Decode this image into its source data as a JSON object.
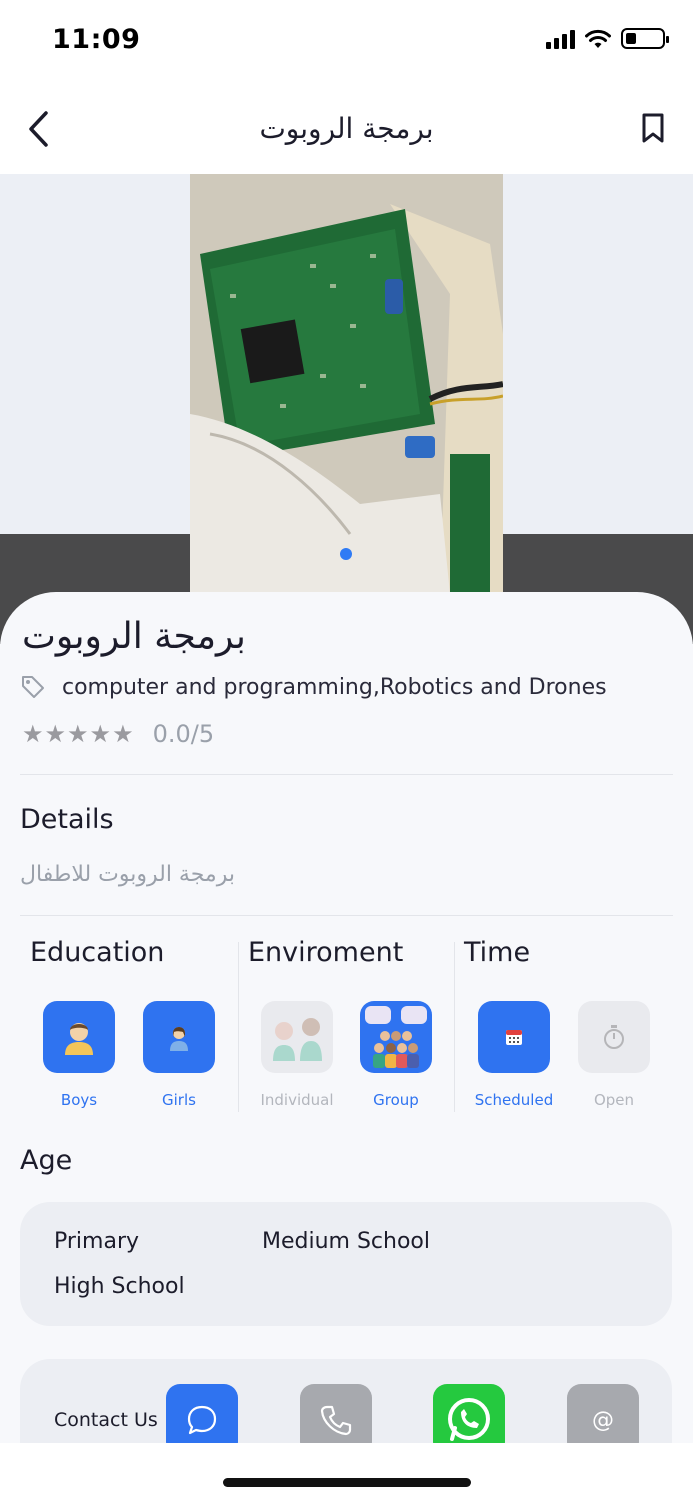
{
  "status_bar": {
    "time": "11:09",
    "battery_level": 0.3
  },
  "nav": {
    "title": "برمجة الروبوت",
    "back_icon": "chevron-left-icon",
    "bookmark_icon": "bookmark-icon"
  },
  "gallery": {
    "image": "circuit-board-photo",
    "page_count": 1,
    "current_page": 1,
    "active_dot_color": "#2f7bf5"
  },
  "course": {
    "title": "برمجة الروبوت",
    "tags": "computer and programming,Robotics and Drones",
    "stars": "★★★★★",
    "rating": "0.0/5"
  },
  "details": {
    "heading": "Details",
    "text": "برمجة الروبوت للاطفال"
  },
  "categories": {
    "education": {
      "heading": "Education",
      "options": [
        {
          "label": "Boys",
          "active": true,
          "icon": "boy-icon"
        },
        {
          "label": "Girls",
          "active": true,
          "icon": "girl-icon"
        }
      ]
    },
    "environment": {
      "heading": "Enviroment",
      "options": [
        {
          "label": "Individual",
          "active": false,
          "icon": "individual-icon"
        },
        {
          "label": "Group",
          "active": true,
          "icon": "group-icon"
        }
      ]
    },
    "time": {
      "heading": "Time",
      "options": [
        {
          "label": "Scheduled",
          "active": true,
          "icon": "calendar-icon"
        },
        {
          "label": "Open",
          "active": false,
          "icon": "stopwatch-icon"
        }
      ]
    }
  },
  "age": {
    "heading": "Age",
    "items": [
      "Primary",
      "Medium School",
      "High School"
    ]
  },
  "contact": {
    "label": "Contact Us",
    "buttons": [
      {
        "icon": "chat-icon",
        "color": "#2f73f0"
      },
      {
        "icon": "phone-icon",
        "color": "#a7a9ae"
      },
      {
        "icon": "whatsapp-icon",
        "color": "#25c93f"
      },
      {
        "icon": "email-icon",
        "color": "#a7a9ae"
      }
    ]
  },
  "colors": {
    "accent": "#2f73f0",
    "muted_text": "#9aa0aa",
    "inactive_label": "#b3b6bd"
  }
}
